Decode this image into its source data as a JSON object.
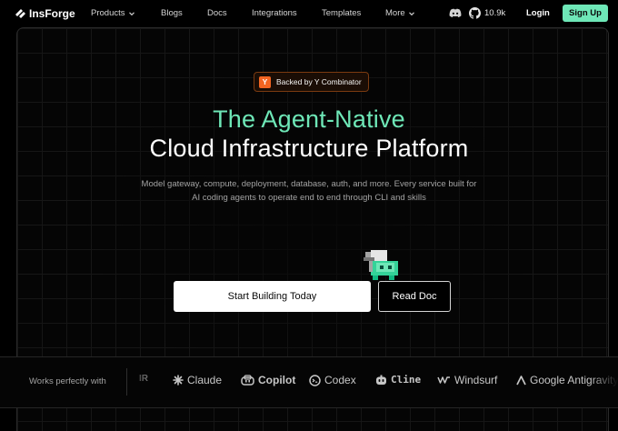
{
  "nav": {
    "brand": "InsForge",
    "links": [
      "Products",
      "Blogs",
      "Docs",
      "Integrations",
      "Templates",
      "More"
    ],
    "github_stars": "10.9k",
    "login": "Login",
    "signup": "Sign Up"
  },
  "hero": {
    "badge": "Backed by Y Combinator",
    "badge_logo": "Y",
    "title_line1": "The Agent-Native",
    "title_line2": "Cloud Infrastructure Platform",
    "subtitle_line1": "Model gateway, compute, deployment, database, auth, and more. Every service built for",
    "subtitle_line2": "AI coding agents to operate end to end through CLI and skills",
    "cta_primary": "Start Building Today",
    "cta_secondary": "Read Doc"
  },
  "works_with": {
    "label": "Works perfectly with",
    "partners": [
      {
        "name": "IR",
        "icon": "cropped-logo-icon"
      },
      {
        "name": "Claude",
        "icon": "claude-star-icon"
      },
      {
        "name": "Copilot",
        "icon": "copilot-icon"
      },
      {
        "name": "Codex",
        "icon": "codex-icon"
      },
      {
        "name": "Cline",
        "icon": "cline-icon"
      },
      {
        "name": "Windsurf",
        "icon": "windsurf-icon"
      },
      {
        "name": "Google Antigravity",
        "icon": "antigravity-icon"
      }
    ]
  },
  "colors": {
    "accent": "#6ee7b7",
    "background": "#000000",
    "yc_orange": "#f26522"
  }
}
